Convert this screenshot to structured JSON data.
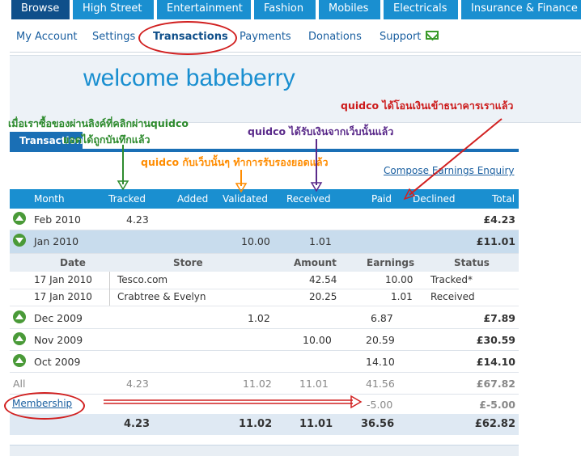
{
  "topnav": {
    "tabs": [
      {
        "label": "Browse"
      },
      {
        "label": "High Street"
      },
      {
        "label": "Entertainment"
      },
      {
        "label": "Fashion"
      },
      {
        "label": "Mobiles"
      },
      {
        "label": "Electricals"
      },
      {
        "label": "Insurance & Finance"
      }
    ]
  },
  "subnav": {
    "items": [
      {
        "label": "My Account"
      },
      {
        "label": "Settings"
      },
      {
        "label": "Transactions"
      },
      {
        "label": "Payments"
      },
      {
        "label": "Donations"
      },
      {
        "label": "Support"
      }
    ],
    "support_icon": "email-icon"
  },
  "welcome": "welcome babeberry",
  "section_tab": "Transactions",
  "compose_link": "Compose Earnings Enquiry",
  "table": {
    "headers": [
      "Month",
      "Tracked",
      "Added",
      "Validated",
      "Received",
      "Paid",
      "Declined",
      "Total"
    ],
    "rows": [
      {
        "month": "Feb 2010",
        "tracked": "4.23",
        "added": "",
        "validated": "",
        "received": "",
        "paid": "",
        "declined": "",
        "total": "£4.23"
      },
      {
        "month": "Jan 2010",
        "tracked": "",
        "added": "",
        "validated": "10.00",
        "received": "1.01",
        "paid": "",
        "declined": "",
        "total": "£11.01"
      },
      {
        "month": "Dec 2009",
        "tracked": "",
        "added": "",
        "validated": "1.02",
        "received": "",
        "paid": "6.87",
        "declined": "",
        "total": "£7.89"
      },
      {
        "month": "Nov 2009",
        "tracked": "",
        "added": "",
        "validated": "",
        "received": "10.00",
        "paid": "20.59",
        "declined": "",
        "total": "£30.59"
      },
      {
        "month": "Oct 2009",
        "tracked": "",
        "added": "",
        "validated": "",
        "received": "",
        "paid": "14.10",
        "declined": "",
        "total": "£14.10"
      }
    ],
    "detail_headers": [
      "Date",
      "Store",
      "Amount",
      "Earnings",
      "Status"
    ],
    "detail_rows": [
      {
        "date": "17 Jan 2010",
        "store": "Tesco.com",
        "amount": "42.54",
        "earnings": "10.00",
        "status": "Tracked*"
      },
      {
        "date": "17 Jan 2010",
        "store": "Crabtree & Evelyn",
        "amount": "20.25",
        "earnings": "1.01",
        "status": "Received"
      }
    ],
    "all_row": {
      "label": "All",
      "tracked": "4.23",
      "validated": "11.02",
      "received": "11.01",
      "paid": "41.56",
      "total": "£67.82"
    },
    "membership_row": {
      "label": "Membership",
      "paid": "-5.00",
      "total": "£-5.00"
    },
    "total_row": {
      "tracked": "4.23",
      "validated": "11.02",
      "received": "11.01",
      "paid": "36.56",
      "total": "£62.82"
    }
  },
  "annotations": {
    "green_line1": "เมื่อเราซื้อของผ่านลิงค์ที่คลิกผ่านquidco",
    "green_line2": "ยอดได้ถูกบันทึกแล้ว",
    "orange": "quidco กับเว็บนั้นๆ ทำการรับรองยอดแล้ว",
    "purple": "quidco ได้รับเงินจากเว็บนั้นแล้ว",
    "red": "quidco ได้โอนเงินเข้าธนาคารเราแล้ว"
  }
}
